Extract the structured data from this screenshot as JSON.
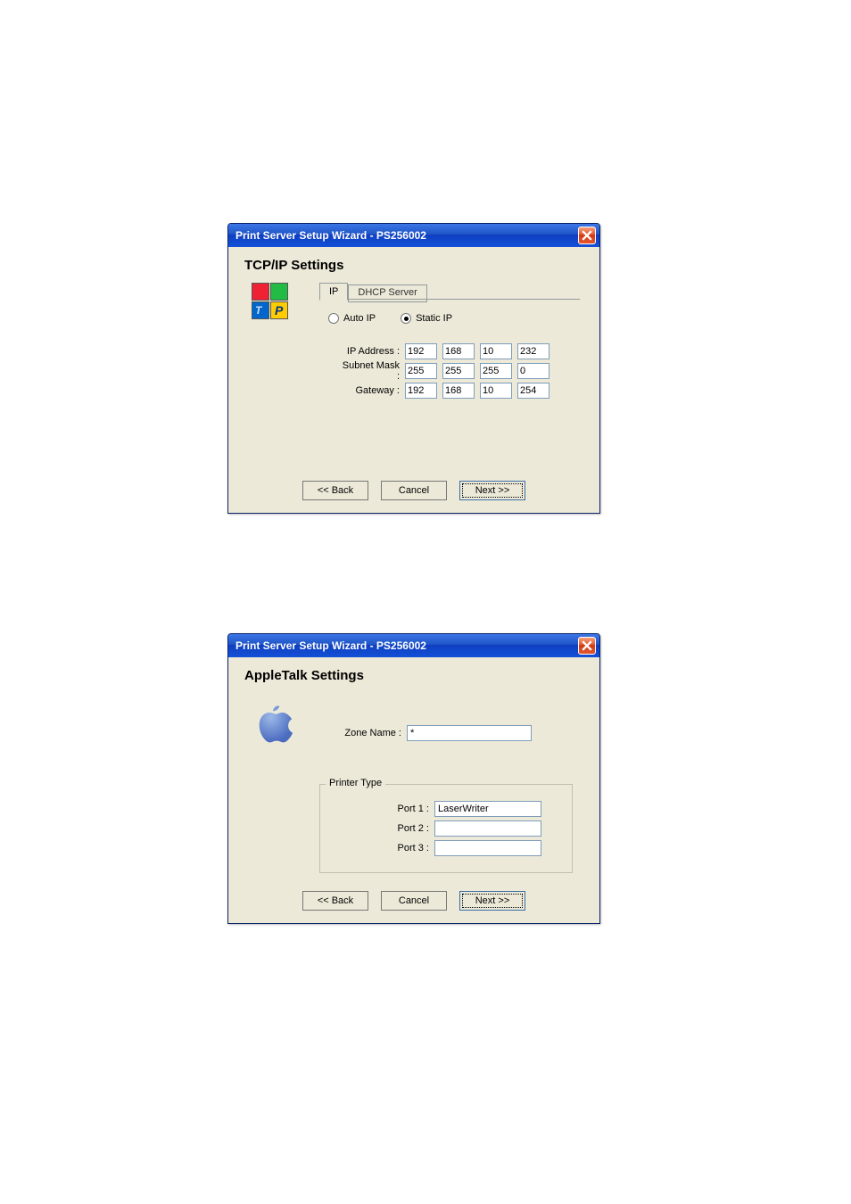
{
  "window1": {
    "title": "Print Server Setup Wizard - PS256002",
    "section": "TCP/IP Settings",
    "tabs": {
      "ip": "IP",
      "dhcp": "DHCP Server"
    },
    "radios": {
      "auto": "Auto IP",
      "static": "Static IP"
    },
    "rows": {
      "ip": {
        "label": "IP Address :",
        "o1": "192",
        "o2": "168",
        "o3": "10",
        "o4": "232"
      },
      "mask": {
        "label": "Subnet Mask :",
        "o1": "255",
        "o2": "255",
        "o3": "255",
        "o4": "0"
      },
      "gateway": {
        "label": "Gateway :",
        "o1": "192",
        "o2": "168",
        "o3": "10",
        "o4": "254"
      }
    },
    "buttons": {
      "back": "<< Back",
      "cancel": "Cancel",
      "next": "Next >>"
    }
  },
  "window2": {
    "title": "Print Server Setup Wizard - PS256002",
    "section": "AppleTalk Settings",
    "zone": {
      "label": "Zone Name :",
      "value": "*"
    },
    "printer_legend": "Printer Type",
    "ports": {
      "p1": {
        "label": "Port 1 :",
        "value": "LaserWriter"
      },
      "p2": {
        "label": "Port 2 :",
        "value": ""
      },
      "p3": {
        "label": "Port 3 :",
        "value": ""
      }
    },
    "buttons": {
      "back": "<< Back",
      "cancel": "Cancel",
      "next": "Next >>"
    }
  }
}
